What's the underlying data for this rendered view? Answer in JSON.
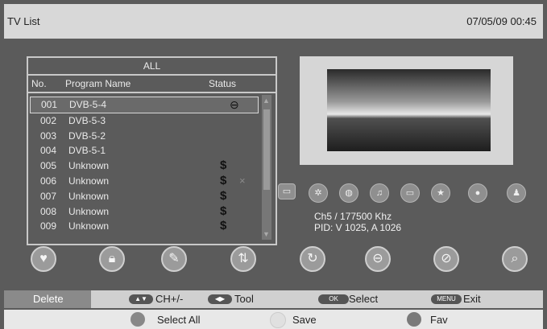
{
  "header": {
    "title": "TV List",
    "datetime": "07/05/09 00:45"
  },
  "list": {
    "category": "ALL",
    "columns": {
      "no": "No.",
      "name": "Program Name",
      "status": "Status"
    },
    "rows": [
      {
        "no": "001",
        "name": "DVB-5-4",
        "status": "skip"
      },
      {
        "no": "002",
        "name": "DVB-5-3",
        "status": ""
      },
      {
        "no": "003",
        "name": "DVB-5-2",
        "status": ""
      },
      {
        "no": "004",
        "name": "DVB-5-1",
        "status": ""
      },
      {
        "no": "005",
        "name": "Unknown",
        "status": "$"
      },
      {
        "no": "006",
        "name": "Unknown",
        "status": "$"
      },
      {
        "no": "007",
        "name": "Unknown",
        "status": "$"
      },
      {
        "no": "008",
        "name": "Unknown",
        "status": "$"
      },
      {
        "no": "009",
        "name": "Unknown",
        "status": "$"
      }
    ],
    "status_glyph": "$",
    "skip_glyph": "⊖",
    "delete_mark": "×"
  },
  "info": {
    "freq": "Ch5 / 177500  Khz",
    "pid": "PID: V 1025, A 1026"
  },
  "hints": {
    "delete": "Delete",
    "ch": "CH+/-",
    "tool": "Tool",
    "ok_key": "OK",
    "select": "Select",
    "menu_key": "MENU",
    "exit": "Exit"
  },
  "footer": {
    "select_all": "Select  All",
    "save": "Save",
    "fav": "Fav"
  },
  "colors": {
    "green": "#888888",
    "white": "#e0e0e0",
    "blue": "#7a7a7a"
  }
}
